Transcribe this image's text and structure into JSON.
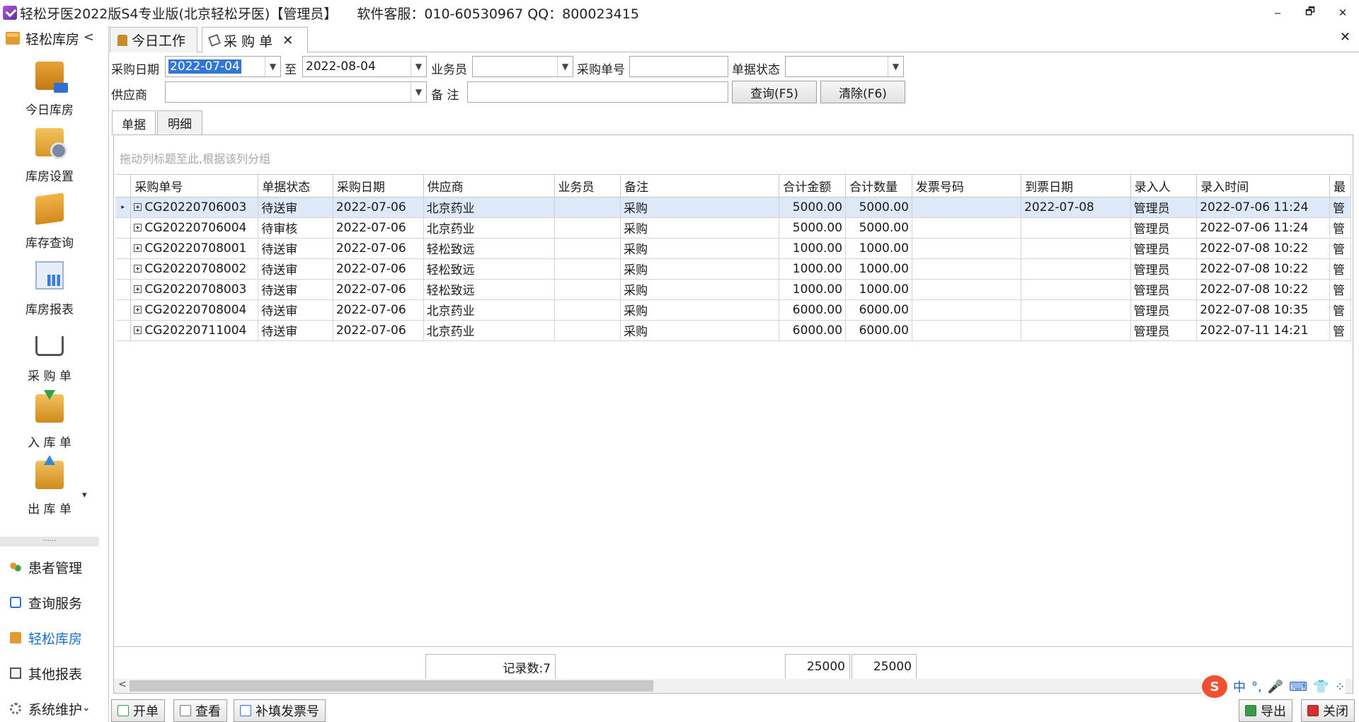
{
  "window": {
    "title": "轻松牙医2022版S4专业版(北京轻松牙医)【管理员】",
    "support": "软件客服：010-60530967 QQ：800023415",
    "min": "‒",
    "restore": "🗗",
    "close": "✕"
  },
  "sidebar": {
    "header": "轻松库房",
    "collapse": "<",
    "items": [
      {
        "label": "今日库房"
      },
      {
        "label": "库房设置"
      },
      {
        "label": "库存查询"
      },
      {
        "label": "库房报表"
      },
      {
        "label": "采 购 单"
      },
      {
        "label": "入 库 单"
      },
      {
        "label": "出 库 单"
      }
    ],
    "scroll_down": "▾",
    "grip": "......",
    "nav": [
      {
        "label": "患者管理"
      },
      {
        "label": "查询服务"
      },
      {
        "label": "轻松库房"
      },
      {
        "label": "其他报表"
      },
      {
        "label": "系统维护"
      }
    ],
    "bottom_chevron": "⌄"
  },
  "tabs": [
    {
      "label": "今日工作"
    },
    {
      "label": "采 购 单",
      "close": "✕"
    }
  ],
  "tabs_close": "✕",
  "filters": {
    "date_label": "采购日期",
    "date_from": "2022-07-04",
    "to_label": "至",
    "date_to": "2022-08-04",
    "staff_label": "业务员",
    "staff_value": "",
    "order_no_label": "采购单号",
    "order_no_value": "",
    "status_label": "单据状态",
    "status_value": "",
    "supplier_label": "供应商",
    "supplier_value": "",
    "remark_label": "备  注",
    "remark_value": "",
    "query_button": "查询(F5)",
    "clear_button": "清除(F6)"
  },
  "subtabs": [
    {
      "label": "单据"
    },
    {
      "label": "明细"
    }
  ],
  "grid": {
    "group_hint": "拖动列标题至此,根据该列分组",
    "columns": [
      "采购单号",
      "单据状态",
      "采购日期",
      "供应商",
      "业务员",
      "备注",
      "合计金额",
      "合计数量",
      "发票号码",
      "到票日期",
      "录入人",
      "录入时间",
      "最"
    ],
    "rows": [
      [
        "CG20220706003",
        "待送审",
        "2022-07-06",
        "北京药业",
        "",
        "采购",
        "5000.00",
        "5000.00",
        "",
        "2022-07-08",
        "管理员",
        "2022-07-06 11:24",
        "管"
      ],
      [
        "CG20220706004",
        "待审核",
        "2022-07-06",
        "北京药业",
        "",
        "采购",
        "5000.00",
        "5000.00",
        "",
        "",
        "管理员",
        "2022-07-06 11:24",
        "管"
      ],
      [
        "CG20220708001",
        "待送审",
        "2022-07-06",
        "轻松致远",
        "",
        "采购",
        "1000.00",
        "1000.00",
        "",
        "",
        "管理员",
        "2022-07-08 10:22",
        "管"
      ],
      [
        "CG20220708002",
        "待送审",
        "2022-07-06",
        "轻松致远",
        "",
        "采购",
        "1000.00",
        "1000.00",
        "",
        "",
        "管理员",
        "2022-07-08 10:22",
        "管"
      ],
      [
        "CG20220708003",
        "待送审",
        "2022-07-06",
        "轻松致远",
        "",
        "采购",
        "1000.00",
        "1000.00",
        "",
        "",
        "管理员",
        "2022-07-08 10:22",
        "管"
      ],
      [
        "CG20220708004",
        "待送审",
        "2022-07-06",
        "北京药业",
        "",
        "采购",
        "6000.00",
        "6000.00",
        "",
        "",
        "管理员",
        "2022-07-08 10:35",
        "管"
      ],
      [
        "CG20220711004",
        "待送审",
        "2022-07-06",
        "北京药业",
        "",
        "采购",
        "6000.00",
        "6000.00",
        "",
        "",
        "管理员",
        "2022-07-11 14:21",
        "管"
      ]
    ],
    "footer": {
      "record_count": "记录数:7",
      "total_amount": "25000",
      "total_qty": "25000"
    },
    "scroll_left": "<"
  },
  "bottom_buttons": {
    "new": "开单",
    "view": "查看",
    "invoice": "补填发票号",
    "export": "导出",
    "close": "关闭"
  },
  "ime": {
    "logo": "S",
    "mode": "中",
    "punct": "°,",
    "mic": "🎤",
    "keyboard": "⌨",
    "skin": "👕",
    "more": "⁘"
  }
}
